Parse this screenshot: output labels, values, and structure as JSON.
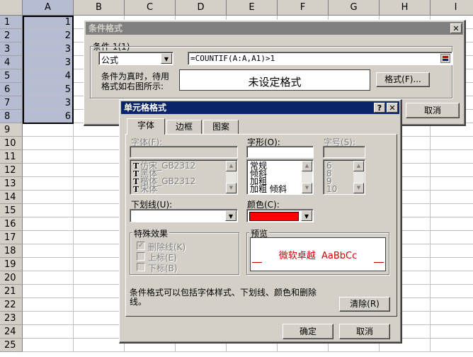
{
  "sheet": {
    "columns": [
      "A",
      "B",
      "C",
      "D",
      "E",
      "F",
      "G",
      "H",
      "I"
    ],
    "rows": [
      "1",
      "2",
      "3",
      "4",
      "5",
      "6",
      "7",
      "8",
      "9",
      "10",
      "11",
      "12",
      "13",
      "14",
      "15",
      "16",
      "17",
      "18",
      "19",
      "20",
      "21",
      "22",
      "23",
      "24",
      "25"
    ],
    "colA_values": [
      "1",
      "2",
      "3",
      "3",
      "4",
      "5",
      "3",
      "6"
    ]
  },
  "cond_dialog": {
    "title": "条件格式",
    "close_icon": "close-icon",
    "condition_label": "条件 1(1)",
    "type_value": "公式",
    "formula_value": "=COUNTIF(A:A,A1)>1",
    "collapse_icon": "collapse-dialog-icon",
    "hint_line1": "条件为真时，待用",
    "hint_line2": "格式如右图所示:",
    "preview_text": "未设定格式",
    "format_button": "格式(F)...",
    "cancel_button": "取消"
  },
  "cell_dialog": {
    "title": "单元格格式",
    "help_icon": "?",
    "close_icon": "close-icon",
    "tabs": [
      "字体",
      "边框",
      "图案"
    ],
    "font_label": "字体(F):",
    "font_list": [
      "仿宋_GB2312",
      "黑体",
      "楷体_GB2312",
      "宋体"
    ],
    "style_label": "字形(O):",
    "style_list": [
      "常规",
      "倾斜",
      "加粗",
      "加粗 倾斜"
    ],
    "size_label": "字号(S):",
    "size_list": [
      "6",
      "8",
      "9",
      "10"
    ],
    "underline_label": "下划线(U):",
    "color_label": "颜色(C):",
    "color_value": "#ff0000",
    "effects_label": "特殊效果",
    "strike_label": "删除线(K)",
    "super_label": "上标(E)",
    "sub_label": "下标(B)",
    "strike_checked": true,
    "preview_label": "预览",
    "preview_sample": "微软卓越  AaBbCc",
    "note": "条件格式可以包括字体样式、下划线、颜色和删除线。",
    "clear_button": "清除(R)",
    "ok_button": "确定",
    "cancel_button": "取消"
  }
}
